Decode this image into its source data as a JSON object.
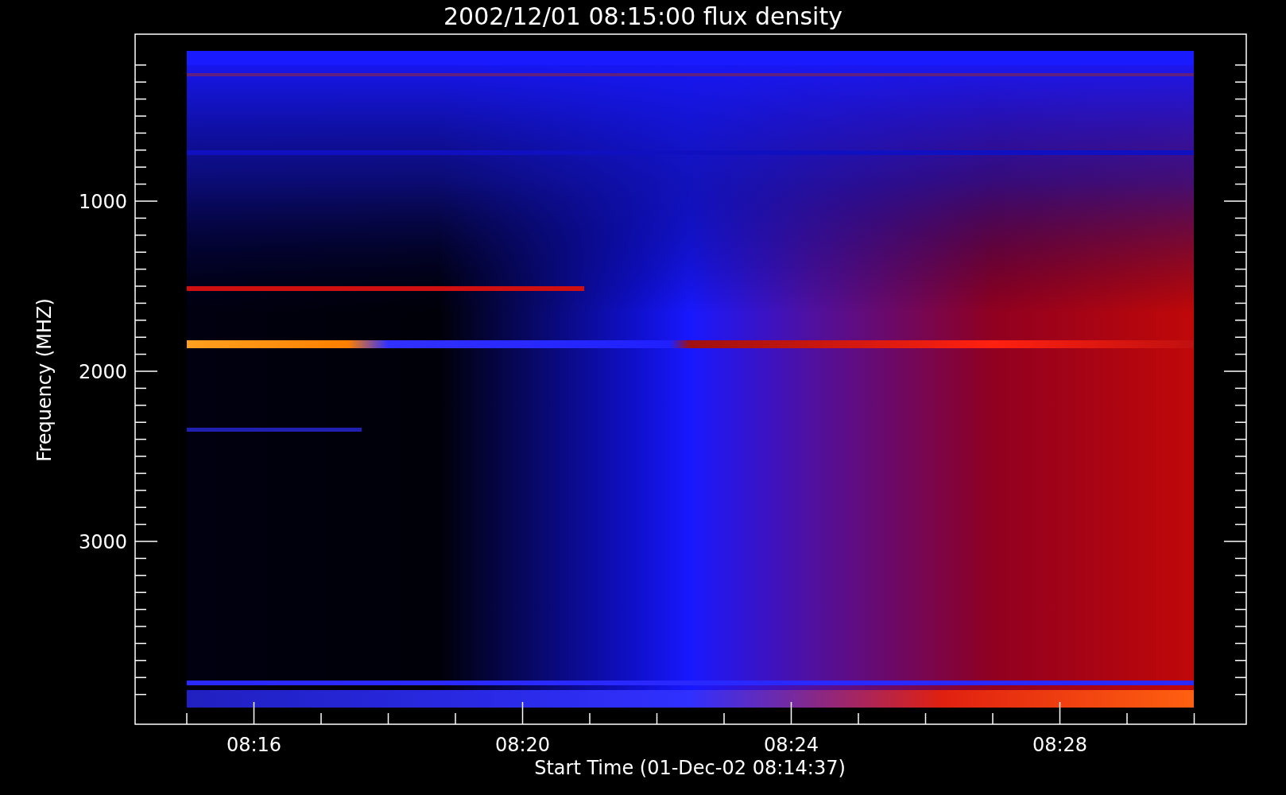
{
  "title": "2002/12/01 08:15:00 flux density",
  "y_axis": {
    "label": "Frequency (MHZ)",
    "ticks": [
      "1000",
      "2000",
      "3000"
    ]
  },
  "x_axis": {
    "label": "Start Time (01-Dec-02 08:14:37)",
    "ticks": [
      "08:16",
      "08:20",
      "08:24",
      "08:28"
    ]
  }
}
